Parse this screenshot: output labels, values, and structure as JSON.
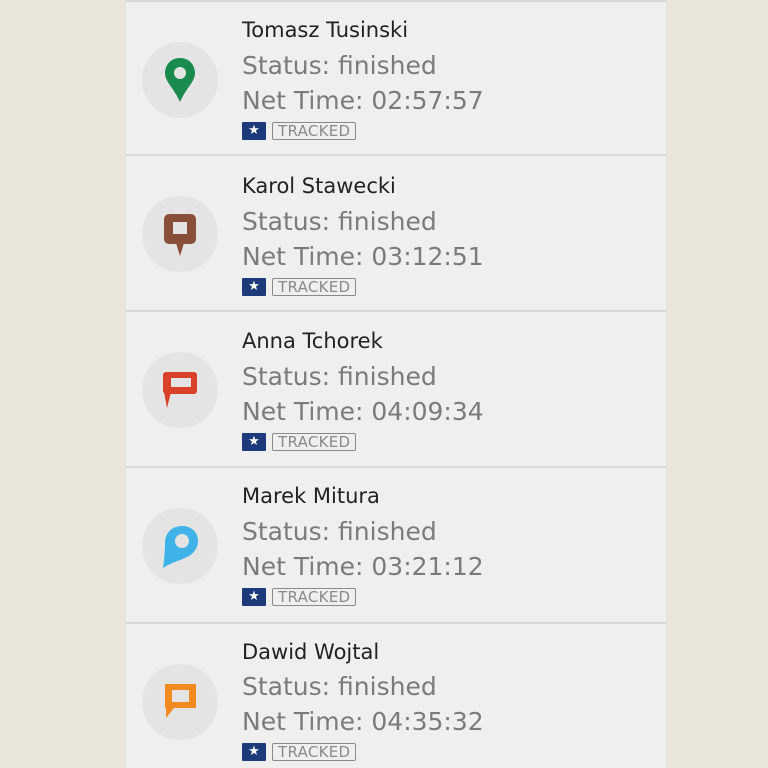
{
  "entries": [
    {
      "name": "Tomasz Tusinski",
      "status": "Status: finished",
      "net_time": "Net Time: 02:57:57",
      "star": "★",
      "badge": "TRACKED",
      "marker_icon": "green-round-pin-icon",
      "marker_color": "#1a8a4e"
    },
    {
      "name": "Karol Stawecki",
      "status": "Status: finished",
      "net_time": "Net Time: 03:12:51",
      "star": "★",
      "badge": "TRACKED",
      "marker_icon": "brown-square-pin-icon",
      "marker_color": "#8a4f3a"
    },
    {
      "name": "Anna Tchorek",
      "status": "Status: finished",
      "net_time": "Net Time: 04:09:34",
      "star": "★",
      "badge": "TRACKED",
      "marker_icon": "red-flag-pin-icon",
      "marker_color": "#d9412a"
    },
    {
      "name": "Marek Mitura",
      "status": "Status: finished",
      "net_time": "Net Time: 03:21:12",
      "star": "★",
      "badge": "TRACKED",
      "marker_icon": "blue-teardrop-pin-icon",
      "marker_color": "#3fb3e8"
    },
    {
      "name": "Dawid Wojtal",
      "status": "Status: finished",
      "net_time": "Net Time: 04:35:32",
      "star": "★",
      "badge": "TRACKED",
      "marker_icon": "orange-speech-pin-icon",
      "marker_color": "#f28a22"
    }
  ],
  "colors": {
    "background": "#e7e6d8",
    "panel": "#efefef",
    "divider": "#d7d7d7",
    "star_badge": "#1d3a7a"
  }
}
